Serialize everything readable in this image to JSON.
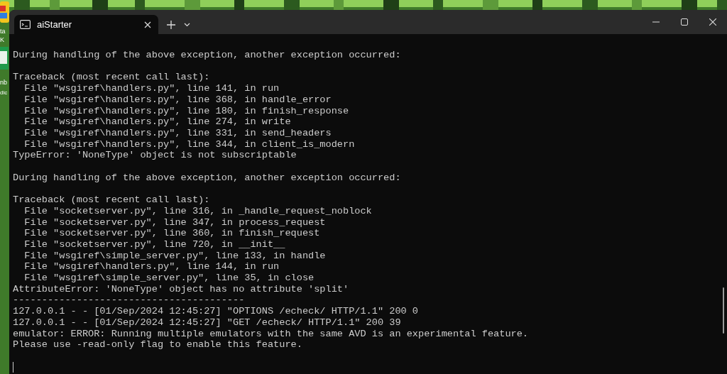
{
  "desktop": {
    "icon_labels": [
      "ta",
      "K",
      "nb",
      "dic"
    ]
  },
  "window": {
    "tabs": [
      {
        "title": "aiStarter",
        "selected": true
      }
    ]
  },
  "terminal": {
    "lines": [
      {
        "kind": "text",
        "text": "During handling of the above exception, another exception occurred:"
      },
      {
        "kind": "blank"
      },
      {
        "kind": "text",
        "text": "Traceback (most recent call last):"
      },
      {
        "kind": "text",
        "text": "  File \"wsgiref\\handlers.py\", line 141, in run"
      },
      {
        "kind": "text",
        "text": "  File \"wsgiref\\handlers.py\", line 368, in handle_error"
      },
      {
        "kind": "text",
        "text": "  File \"wsgiref\\handlers.py\", line 180, in finish_response"
      },
      {
        "kind": "text",
        "text": "  File \"wsgiref\\handlers.py\", line 274, in write"
      },
      {
        "kind": "text",
        "text": "  File \"wsgiref\\handlers.py\", line 331, in send_headers"
      },
      {
        "kind": "text",
        "text": "  File \"wsgiref\\handlers.py\", line 344, in client_is_modern"
      },
      {
        "kind": "text",
        "text": "TypeError: 'NoneType' object is not subscriptable"
      },
      {
        "kind": "blank"
      },
      {
        "kind": "text",
        "text": "During handling of the above exception, another exception occurred:"
      },
      {
        "kind": "blank"
      },
      {
        "kind": "text",
        "text": "Traceback (most recent call last):"
      },
      {
        "kind": "text",
        "text": "  File \"socketserver.py\", line 316, in _handle_request_noblock"
      },
      {
        "kind": "text",
        "text": "  File \"socketserver.py\", line 347, in process_request"
      },
      {
        "kind": "text",
        "text": "  File \"socketserver.py\", line 360, in finish_request"
      },
      {
        "kind": "text",
        "text": "  File \"socketserver.py\", line 720, in __init__"
      },
      {
        "kind": "text",
        "text": "  File \"wsgiref\\simple_server.py\", line 133, in handle"
      },
      {
        "kind": "text",
        "text": "  File \"wsgiref\\handlers.py\", line 144, in run"
      },
      {
        "kind": "text",
        "text": "  File \"wsgiref\\simple_server.py\", line 35, in close"
      },
      {
        "kind": "text",
        "text": "AttributeError: 'NoneType' object has no attribute 'split'"
      },
      {
        "kind": "text",
        "text": "----------------------------------------"
      },
      {
        "kind": "text",
        "text": "127.0.0.1 - - [01/Sep/2024 12:45:27] \"OPTIONS /echeck/ HTTP/1.1\" 200 0"
      },
      {
        "kind": "text",
        "text": "127.0.0.1 - - [01/Sep/2024 12:45:27] \"GET /echeck/ HTTP/1.1\" 200 39"
      },
      {
        "kind": "text",
        "text": "emulator: ERROR: Running multiple emulators with the same AVD is an experimental feature."
      },
      {
        "kind": "text",
        "text": "Please use -read-only flag to enable this feature."
      },
      {
        "kind": "blank"
      }
    ]
  }
}
